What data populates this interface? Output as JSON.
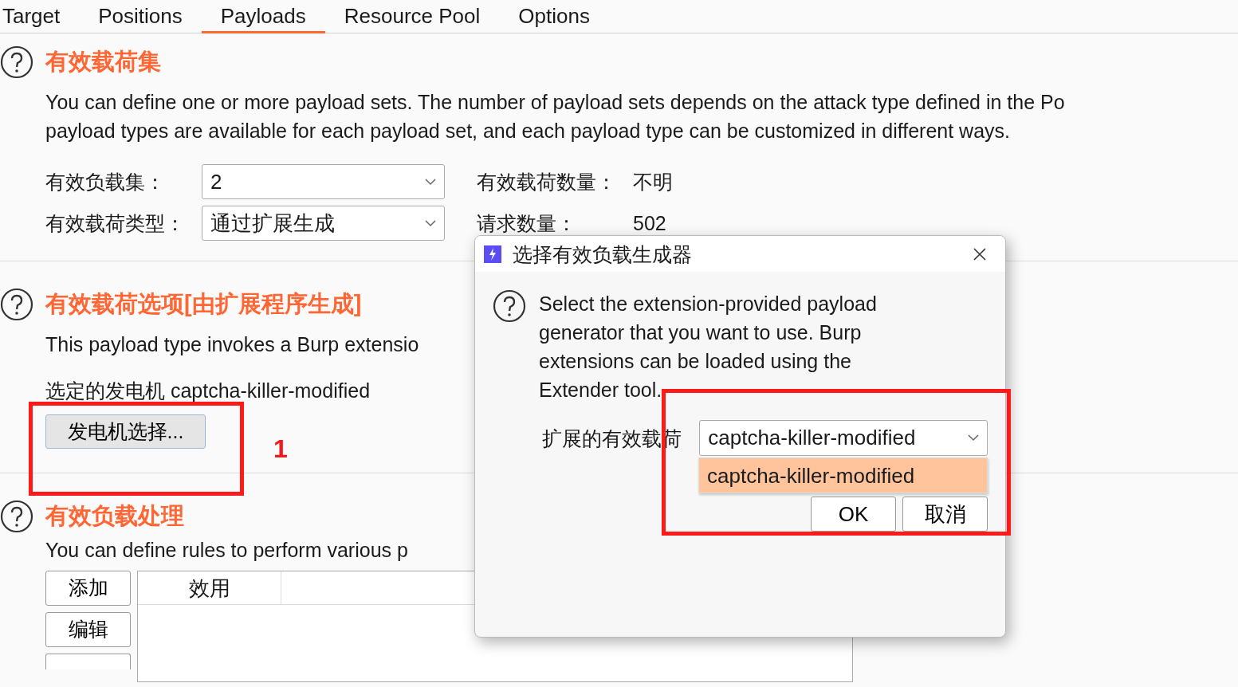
{
  "tabs": [
    {
      "label": "Target",
      "selected": false
    },
    {
      "label": "Positions",
      "selected": false
    },
    {
      "label": "Payloads",
      "selected": true
    },
    {
      "label": "Resource Pool",
      "selected": false
    },
    {
      "label": "Options",
      "selected": false
    }
  ],
  "payload_sets": {
    "title": "有效载荷集",
    "description": [
      "You can define one or more payload sets. The number of payload sets depends on the attack type defined in the Po",
      "payload types are available for each payload set, and each payload type can be customized in different ways."
    ],
    "fields": [
      {
        "label": "有效负载集：",
        "value": "2"
      },
      {
        "label": "有效载荷类型：",
        "value": "通过扩展生成"
      }
    ],
    "stats": [
      {
        "label": "有效载荷数量：",
        "value": "不明"
      },
      {
        "label": "请求数量：",
        "value": "502"
      }
    ]
  },
  "payload_options": {
    "title": "有效载荷选项[由扩展程序生成]",
    "description": "This payload type invokes a Burp extensio",
    "selected_generator": "选定的发电机 captcha-killer-modified",
    "button": "发电机选择..."
  },
  "payload_processing": {
    "title": "有效负载处理",
    "description": "You can define rules to perform various p",
    "buttons": [
      "添加",
      "编辑"
    ],
    "table": {
      "columns": [
        "效用"
      ]
    }
  },
  "dialog": {
    "title": "选择有效负载生成器",
    "message": [
      "Select the extension-provided payload",
      "generator that you want to use. Burp",
      "extensions can be loaded using the",
      "Extender tool."
    ],
    "field": {
      "label": "扩展的有效载荷",
      "value": "captcha-killer-modified"
    },
    "dropdown_items": [
      {
        "label": "captcha-killer-modified",
        "selected": true
      }
    ],
    "buttons": [
      "OK",
      "取消"
    ]
  },
  "annotation": {
    "step_label": "1"
  }
}
